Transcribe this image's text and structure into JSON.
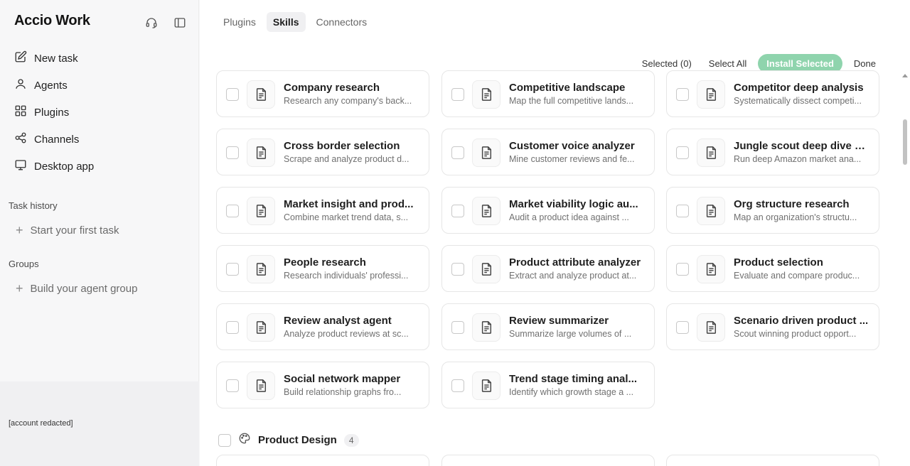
{
  "app": {
    "name": "Accio Work"
  },
  "sidebar": {
    "nav": [
      {
        "label": "New task",
        "icon": "edit-icon"
      },
      {
        "label": "Agents",
        "icon": "user-icon"
      },
      {
        "label": "Plugins",
        "icon": "plugin-icon"
      },
      {
        "label": "Channels",
        "icon": "channels-icon"
      },
      {
        "label": "Desktop app",
        "icon": "monitor-icon"
      }
    ],
    "task_history": {
      "label": "Task history",
      "action": "Start your first task"
    },
    "groups": {
      "label": "Groups",
      "action": "Build your agent group"
    },
    "account": "[account redacted]"
  },
  "tabs": [
    {
      "label": "Plugins",
      "active": false
    },
    {
      "label": "Skills",
      "active": true
    },
    {
      "label": "Connectors",
      "active": false
    }
  ],
  "toolbar": {
    "selected": "Selected (0)",
    "select_all": "Select All",
    "install": "Install Selected",
    "done": "Done",
    "install_color": "#8fd4ad"
  },
  "skills": [
    {
      "title": "Company research",
      "desc": "Research any company's back..."
    },
    {
      "title": "Competitive landscape",
      "desc": "Map the full competitive lands..."
    },
    {
      "title": "Competitor deep analysis",
      "desc": "Systematically dissect competi..."
    },
    {
      "title": "Cross border selection",
      "desc": "Scrape and analyze product d..."
    },
    {
      "title": "Customer voice analyzer",
      "desc": "Mine customer reviews and fe..."
    },
    {
      "title": "Jungle scout deep dive a...",
      "desc": "Run deep Amazon market ana..."
    },
    {
      "title": "Market insight and prod...",
      "desc": "Combine market trend data, s..."
    },
    {
      "title": "Market viability logic au...",
      "desc": "Audit a product idea against ..."
    },
    {
      "title": "Org structure research",
      "desc": "Map an organization's structu..."
    },
    {
      "title": "People research",
      "desc": "Research individuals' professi..."
    },
    {
      "title": "Product attribute analyzer",
      "desc": "Extract and analyze product at..."
    },
    {
      "title": "Product selection",
      "desc": "Evaluate and compare produc..."
    },
    {
      "title": "Review analyst agent",
      "desc": "Analyze product reviews at sc..."
    },
    {
      "title": "Review summarizer",
      "desc": "Summarize large volumes of ..."
    },
    {
      "title": "Scenario driven product ...",
      "desc": "Scout winning product opport..."
    },
    {
      "title": "Social network mapper",
      "desc": "Build relationship graphs fro..."
    },
    {
      "title": "Trend stage timing anal...",
      "desc": "Identify which growth stage a ..."
    }
  ],
  "next_group": {
    "title": "Product Design",
    "count": "4"
  }
}
